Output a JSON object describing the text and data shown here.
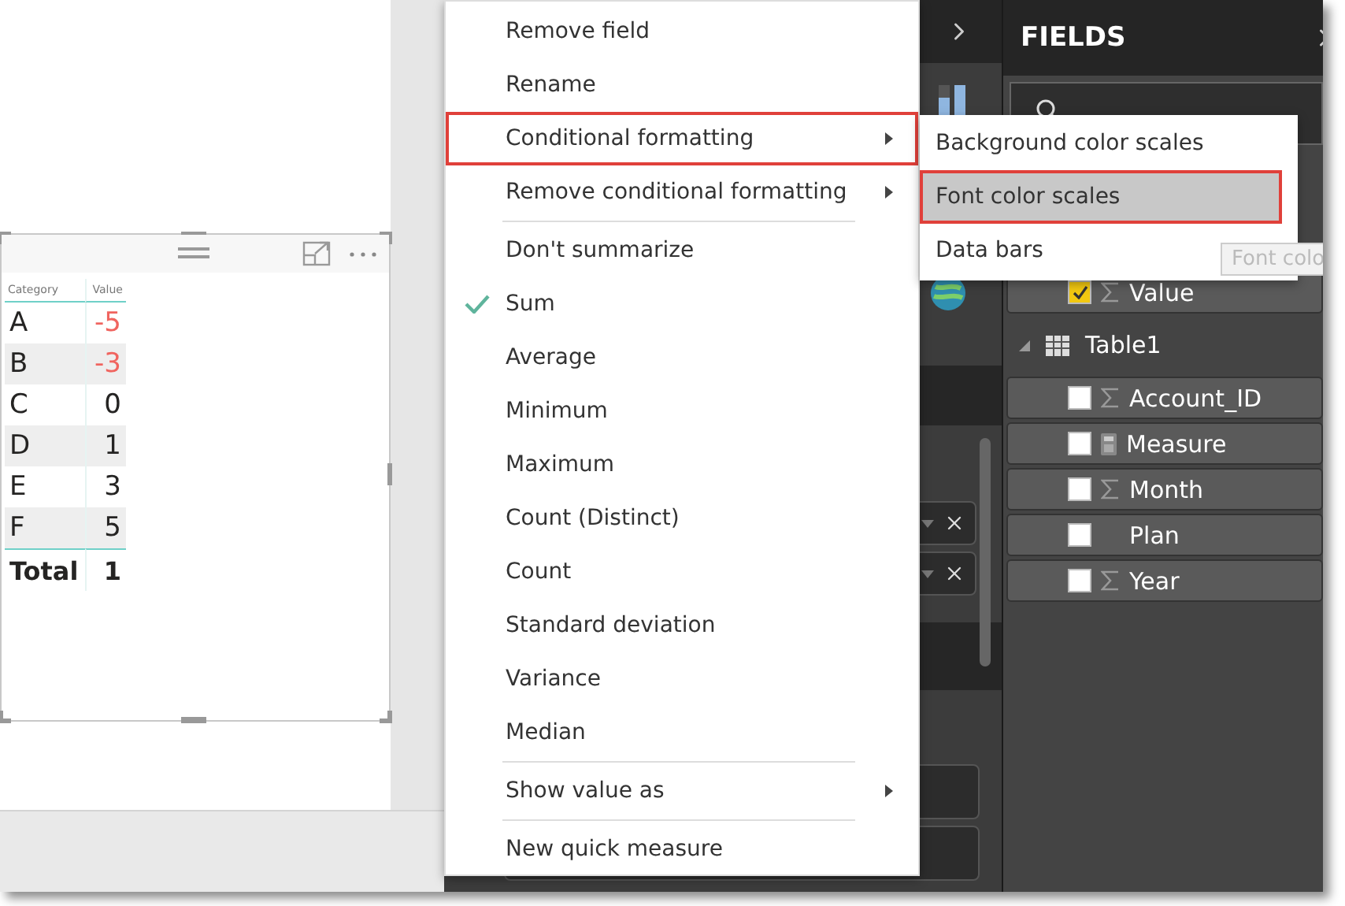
{
  "table_visual": {
    "columns": [
      "Category",
      "Value"
    ],
    "rows": [
      {
        "category": "A",
        "value": "-5",
        "color": "#f0645f",
        "shaded": false
      },
      {
        "category": "B",
        "value": "-3",
        "color": "#f0645f",
        "shaded": true
      },
      {
        "category": "C",
        "value": "0",
        "color": "#252423",
        "shaded": false
      },
      {
        "category": "D",
        "value": "1",
        "color": "#252423",
        "shaded": true
      },
      {
        "category": "E",
        "value": "3",
        "color": "#252423",
        "shaded": false
      },
      {
        "category": "F",
        "value": "5",
        "color": "#252423",
        "shaded": true
      }
    ],
    "total": {
      "label": "Total",
      "value": "1"
    }
  },
  "context_menu": [
    {
      "kind": "item",
      "label": "Remove field",
      "checked": false,
      "submenu": false,
      "highlighted": false
    },
    {
      "kind": "item",
      "label": "Rename",
      "checked": false,
      "submenu": false,
      "highlighted": false
    },
    {
      "kind": "item",
      "label": "Conditional formatting",
      "checked": false,
      "submenu": true,
      "highlighted": true
    },
    {
      "kind": "item",
      "label": "Remove conditional formatting",
      "checked": false,
      "submenu": true,
      "highlighted": false
    },
    {
      "kind": "separator"
    },
    {
      "kind": "item",
      "label": "Don't summarize",
      "checked": false,
      "submenu": false,
      "highlighted": false
    },
    {
      "kind": "item",
      "label": "Sum",
      "checked": true,
      "submenu": false,
      "highlighted": false
    },
    {
      "kind": "item",
      "label": "Average",
      "checked": false,
      "submenu": false,
      "highlighted": false
    },
    {
      "kind": "item",
      "label": "Minimum",
      "checked": false,
      "submenu": false,
      "highlighted": false
    },
    {
      "kind": "item",
      "label": "Maximum",
      "checked": false,
      "submenu": false,
      "highlighted": false
    },
    {
      "kind": "item",
      "label": "Count (Distinct)",
      "checked": false,
      "submenu": false,
      "highlighted": false
    },
    {
      "kind": "item",
      "label": "Count",
      "checked": false,
      "submenu": false,
      "highlighted": false
    },
    {
      "kind": "item",
      "label": "Standard deviation",
      "checked": false,
      "submenu": false,
      "highlighted": false
    },
    {
      "kind": "item",
      "label": "Variance",
      "checked": false,
      "submenu": false,
      "highlighted": false
    },
    {
      "kind": "item",
      "label": "Median",
      "checked": false,
      "submenu": false,
      "highlighted": false
    },
    {
      "kind": "separator"
    },
    {
      "kind": "item",
      "label": "Show value as",
      "checked": false,
      "submenu": true,
      "highlighted": false
    },
    {
      "kind": "separator"
    },
    {
      "kind": "item",
      "label": "New quick measure",
      "checked": false,
      "submenu": false,
      "highlighted": false
    }
  ],
  "submenu": [
    {
      "label": "Background color scales",
      "selected": false
    },
    {
      "label": "Font color scales",
      "selected": true
    },
    {
      "label": "Data bars",
      "selected": false
    }
  ],
  "tooltip": "Font colo",
  "fields_pane": {
    "title": "FIELDS",
    "value_field": {
      "label": "Value",
      "checked": true,
      "kind": "sigma"
    },
    "table": {
      "name": "Table1",
      "expanded": true,
      "fields": [
        {
          "label": "Account_ID",
          "checked": false,
          "kind": "sigma"
        },
        {
          "label": "Measure",
          "checked": false,
          "kind": "calculator"
        },
        {
          "label": "Month",
          "checked": false,
          "kind": "sigma"
        },
        {
          "label": "Plan",
          "checked": false,
          "kind": "plain"
        },
        {
          "label": "Year",
          "checked": false,
          "kind": "sigma"
        }
      ]
    }
  }
}
